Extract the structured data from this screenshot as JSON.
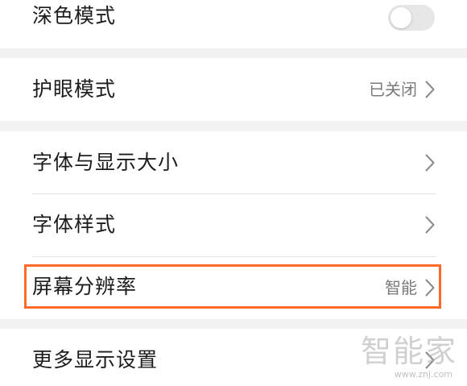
{
  "colors": {
    "highlight": "#ff6a2a",
    "background": "#f2f2f2",
    "card": "#ffffff",
    "value_text": "#7a7a7a"
  },
  "settings": {
    "dark_mode": {
      "label": "深色模式",
      "toggle_on": false
    },
    "eye_protection": {
      "label": "护眼模式",
      "value": "已关闭",
      "icon": "chevron-right-icon"
    },
    "font_display_size": {
      "label": "字体与显示大小",
      "icon": "chevron-right-icon"
    },
    "font_style": {
      "label": "字体样式",
      "icon": "chevron-right-icon"
    },
    "screen_resolution": {
      "label": "屏幕分辨率",
      "value": "智能",
      "icon": "chevron-right-icon",
      "highlighted": true
    },
    "more_display": {
      "label": "更多显示设置",
      "icon": "chevron-right-icon"
    }
  },
  "watermark": {
    "title": "智能家",
    "url": "www.znj.com"
  }
}
